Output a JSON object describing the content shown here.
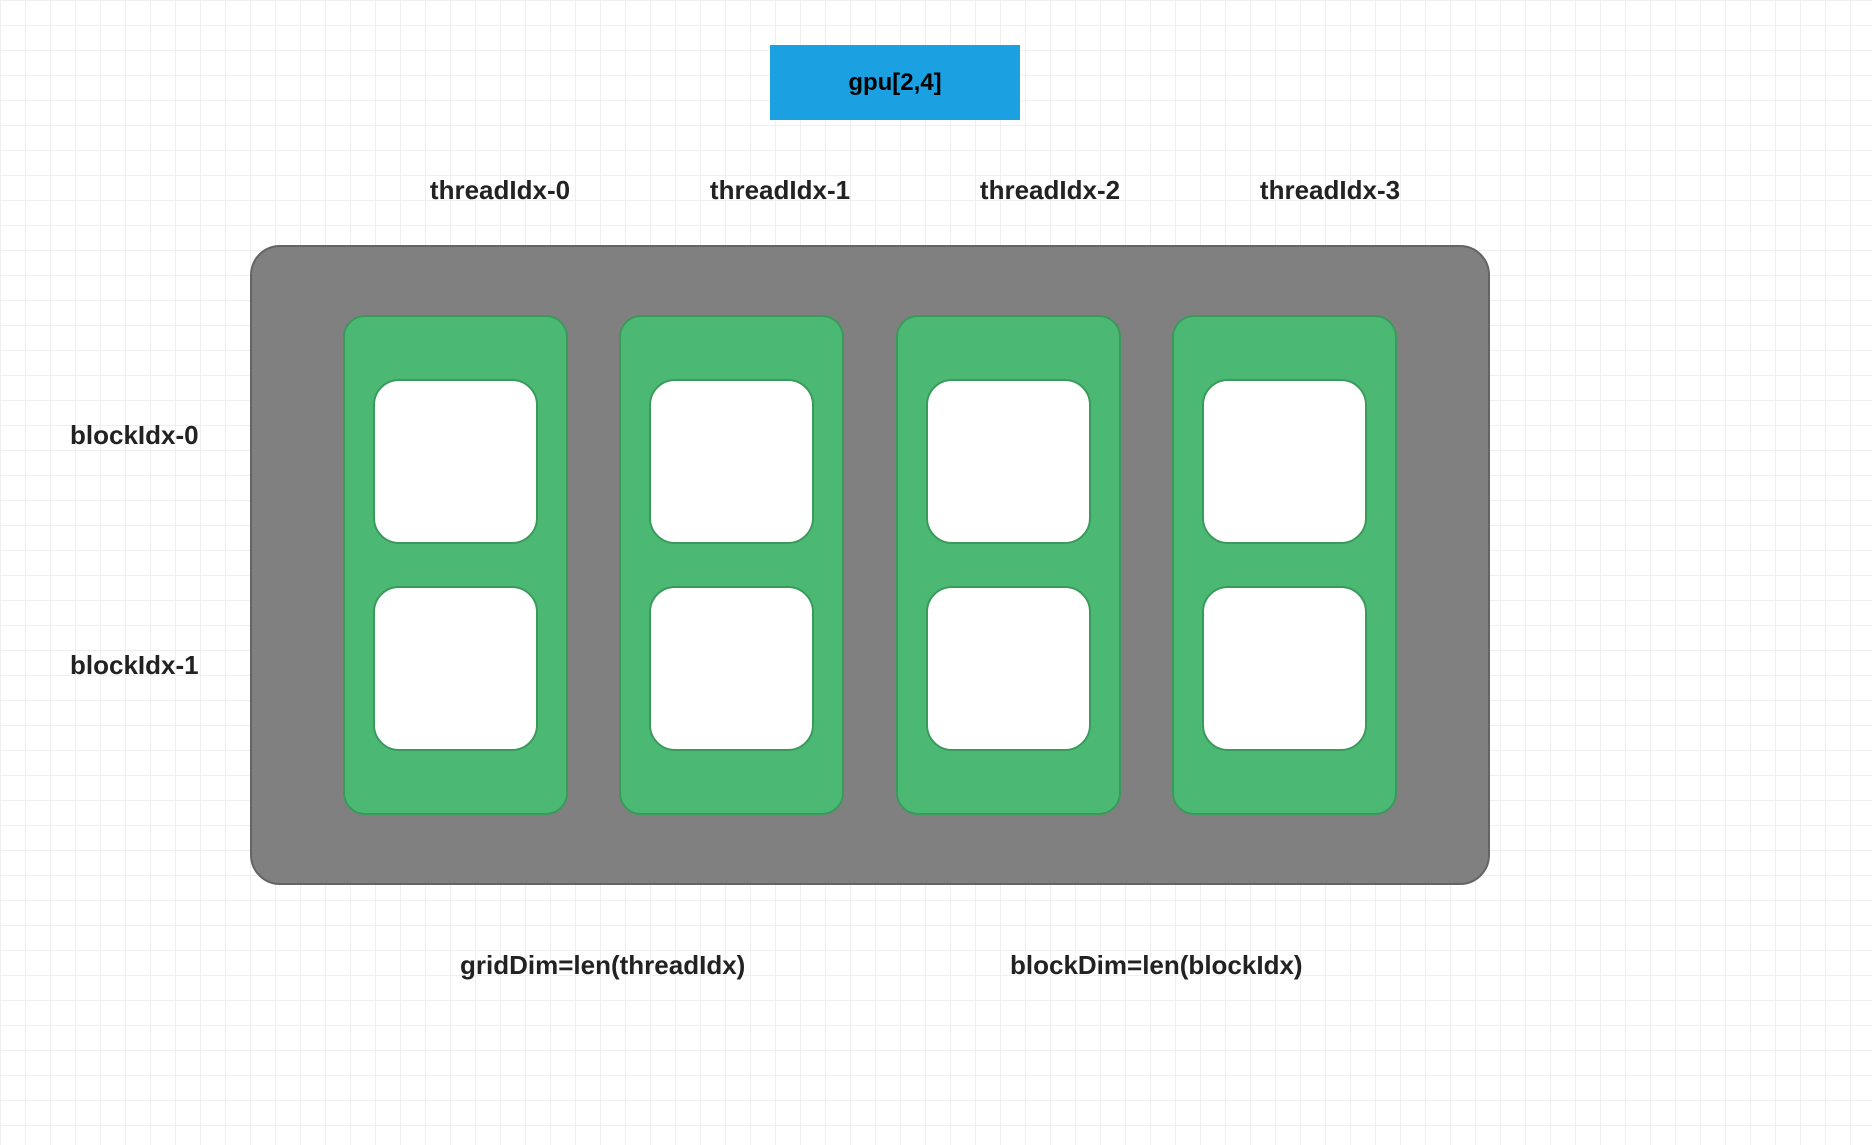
{
  "title": "gpu[2,4]",
  "threadHeaders": [
    "threadIdx-0",
    "threadIdx-1",
    "threadIdx-2",
    "threadIdx-3"
  ],
  "blockLabels": [
    "blockIdx-0",
    "blockIdx-1"
  ],
  "footer": {
    "gridDim": "gridDim=len(threadIdx)",
    "blockDim": "blockDim=len(blockIdx)"
  },
  "grid": {
    "columns": 4,
    "rows": 2
  },
  "colors": {
    "chip": "#1ba1e2",
    "container": "#808080",
    "column": "#4bb973",
    "cell": "#ffffff"
  }
}
